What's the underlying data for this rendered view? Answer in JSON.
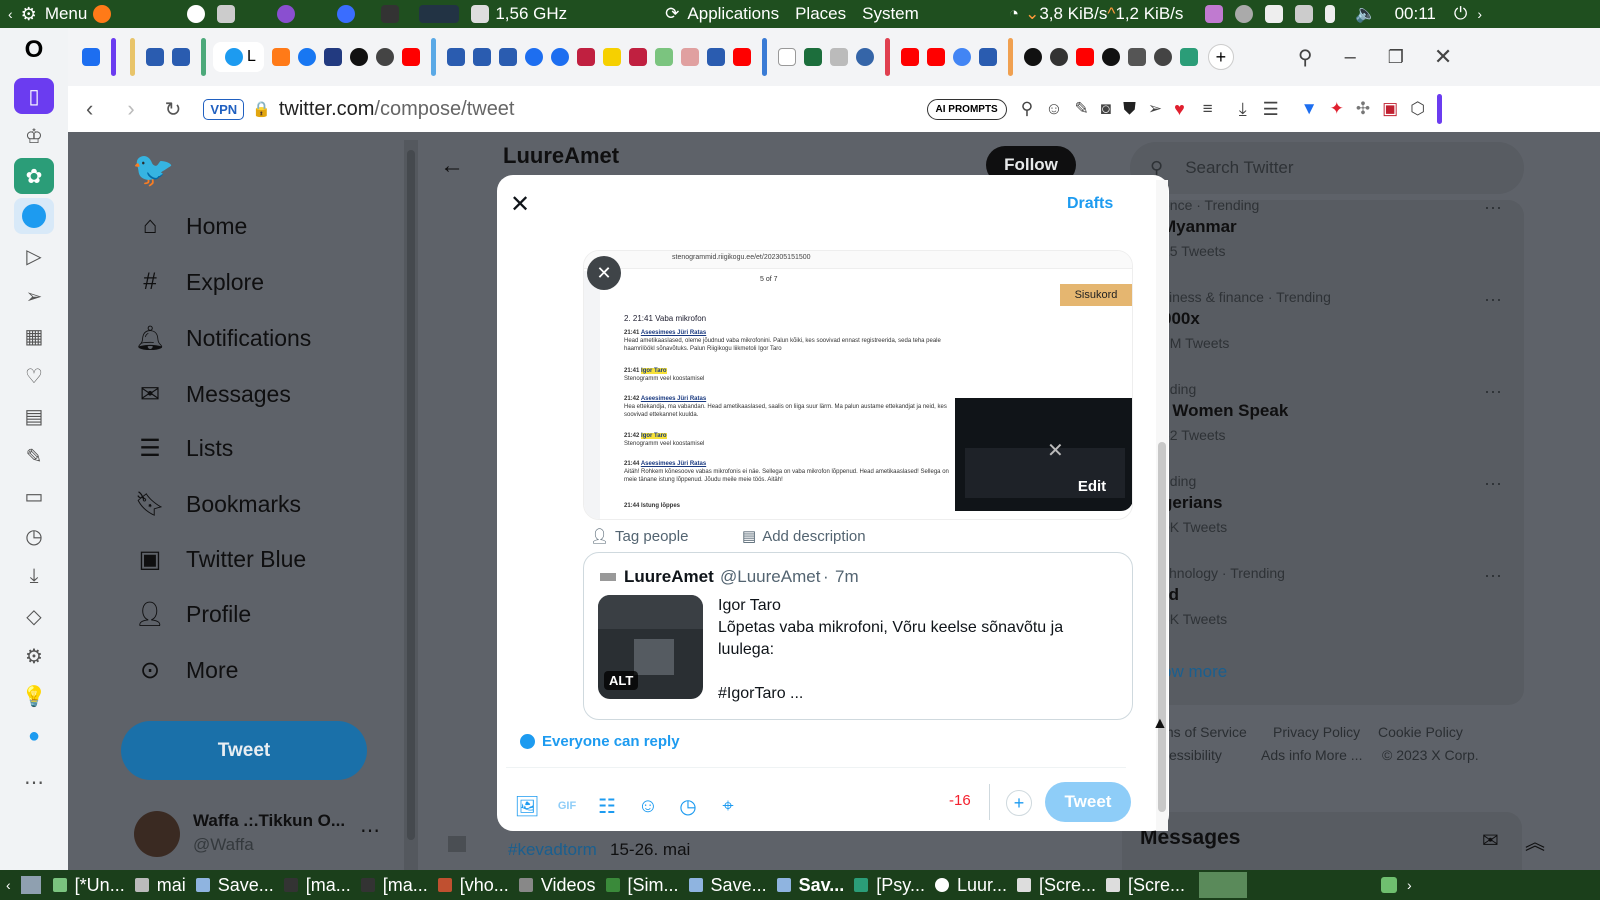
{
  "system_panel": {
    "menu_label": "Menu",
    "cpu_freq": "1,56 GHz",
    "menus": [
      "Applications",
      "Places",
      "System"
    ],
    "net_down": "3,8 KiB/s",
    "net_up": "1,2 KiB/s",
    "clock": "00:11"
  },
  "browser": {
    "vpn_badge": "VPN",
    "url_host": "twitter.com",
    "url_path": "/compose/tweet",
    "ai_prompts": "AI PROMPTS",
    "tab_title_fragment": "L"
  },
  "sidebar": {
    "items": [
      {
        "label": "Home",
        "icon": "home-icon"
      },
      {
        "label": "Explore",
        "icon": "hashtag-icon"
      },
      {
        "label": "Notifications",
        "icon": "bell-icon"
      },
      {
        "label": "Messages",
        "icon": "envelope-icon"
      },
      {
        "label": "Lists",
        "icon": "list-icon"
      },
      {
        "label": "Bookmarks",
        "icon": "bookmark-icon"
      },
      {
        "label": "Twitter Blue",
        "icon": "twitter-blue-icon"
      },
      {
        "label": "Profile",
        "icon": "person-icon"
      },
      {
        "label": "More",
        "icon": "more-circle-icon"
      }
    ],
    "tweet_button": "Tweet",
    "account_name": "Waffa .:.Tikkun O...",
    "account_handle": "@Waffa"
  },
  "profile_header": {
    "name": "LuureAmet",
    "follow_label": "Follow"
  },
  "right_column": {
    "search_placeholder": "Search Twitter",
    "trends": [
      {
        "meta": "ence · Trending",
        "title": "Myanmar",
        "count": "15 Tweets"
      },
      {
        "meta": "siness & finance · Trending",
        "title": "000x",
        "count": "7M Tweets"
      },
      {
        "meta": "nding",
        "title": "t Women Speak",
        "count": "62 Tweets"
      },
      {
        "meta": "nding",
        "title": "gerians",
        "count": "0K Tweets"
      },
      {
        "meta": "chnology · Trending",
        "title": "rd",
        "count": "6K Tweets"
      }
    ],
    "show_more": "ow more",
    "footer_links": [
      "ms of Service",
      "Privacy Policy",
      "Cookie Policy",
      "cessibility",
      "Ads info",
      "More ...",
      "© 2023 X Corp."
    ],
    "messages_title": "Messages"
  },
  "modal": {
    "drafts_label": "Drafts",
    "media_edit_label": "Edit",
    "tag_people": "Tag people",
    "add_description": "Add description",
    "screenshot": {
      "url": "stenogrammid.riigikogu.ee/et/202305151500",
      "page_counter": "5 of 7",
      "toc_button": "Sisukord",
      "heading": "2. 21:41 Vaba mikrofon",
      "blocks": [
        {
          "time": "21:41",
          "speaker": "Aseesimees Jüri Ratas",
          "text": "Head ametikaaslased, oleme jõudnud vaba mikrofonini. Palun kõiki, kes soovivad ennast registreerida, seda teha peale haamrilöökl sõnavõtuks. Palun Riigikogu liikmetoli Igor Taro"
        },
        {
          "time": "21:41",
          "speaker": "Igor Taro",
          "text": "Stenogramm veel koostamisel"
        },
        {
          "time": "21:42",
          "speaker": "Aseesimees Jüri Ratas",
          "text": "Hea ettekandja, ma vabandan. Head ametikaaslased, saalis on liiga suur lärm. Ma palun austame ettekandjat ja neid, kes soovivad ettekannet kuulda."
        },
        {
          "time": "21:42",
          "speaker": "Igor Taro",
          "text": "Stenogramm veel koostamisel"
        },
        {
          "time": "21:44",
          "speaker": "Aseesimees Jüri Ratas",
          "text": "Aitäh! Rohkem kõnesoove vabas mikrofonis ei näe. Sellega on vaba mikrofon lõppenud. Head ametikaaslased! Sellega on meie tänane istung lõppenud. Jõudu meile meie töös. Aitäh!"
        }
      ],
      "closing": "21:44 Istung lõppes"
    },
    "quote": {
      "name": "LuureAmet",
      "handle": "@LuureAmet",
      "age": "7m",
      "line1": "Igor Taro",
      "line2": "Lõpetas vaba mikrofoni, Võru keelse sõnavõtu ja luulega:",
      "line3": "#IgorTaro ...",
      "alt_badge": "ALT"
    },
    "reply_setting": "Everyone can reply",
    "char_count": "-16",
    "tweet_button": "Tweet"
  },
  "background_tweet": {
    "hashtag": "#kevadtorm",
    "text": "15-26. mai"
  },
  "taskbar": {
    "items": [
      "[*Un...",
      "mai",
      "Save...",
      "[ma...",
      "[ma...",
      "[vho...",
      "Videos",
      "[Sim...",
      "Save...",
      "Sav...",
      "[Psy...",
      "Luur...",
      "[Scre...",
      "[Scre..."
    ]
  },
  "colors": {
    "twitter_blue": "#1d9bf0",
    "panel_green": "#1f4f1f",
    "overlay_gray": "#5e6269",
    "error_red": "#f4212e"
  }
}
